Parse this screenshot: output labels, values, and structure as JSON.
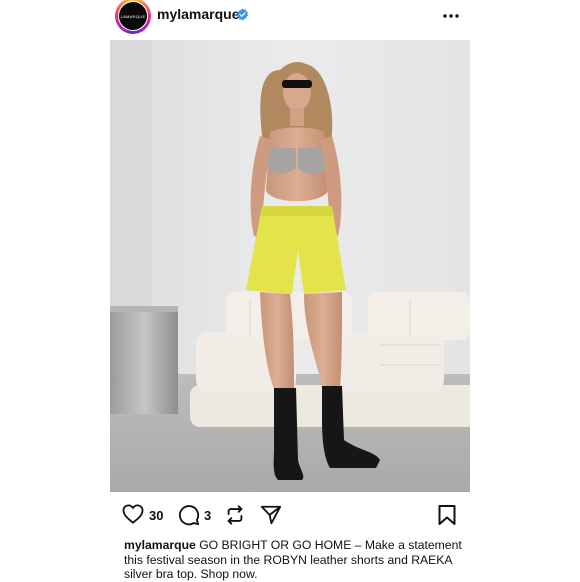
{
  "post": {
    "username": "mylamarque",
    "avatar_text": "LAMARQUE",
    "verified_icon": "verified-badge-icon",
    "more_icon": "more-options-icon",
    "like_count": "30",
    "comment_count": "3",
    "caption_username": "mylamarque",
    "caption_text": " GO BRIGHT OR GO HOME – Make a statement this festival season in the ROBYN leather shorts and RAEKA silver bra top. Shop now."
  },
  "colors": {
    "verified": "#3797f0",
    "shorts": "#e3e34a",
    "boots": "#161616",
    "sofa": "#efebe3"
  }
}
